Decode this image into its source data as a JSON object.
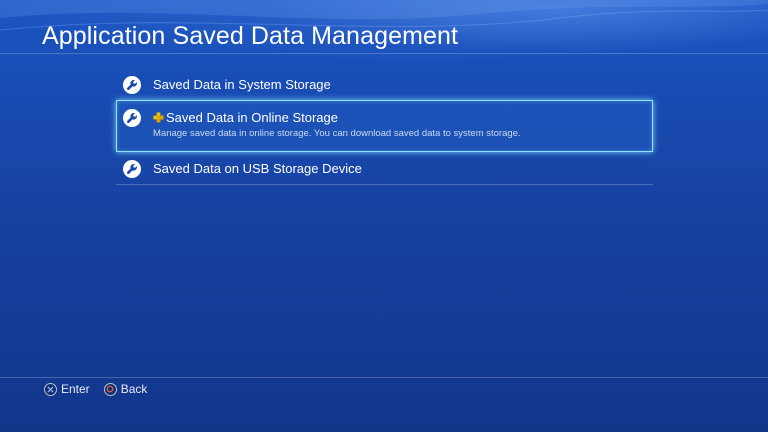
{
  "header": {
    "title": "Application Saved Data Management"
  },
  "menu": {
    "items": [
      {
        "label": "Saved Data in System Storage",
        "icon": "wrench-icon"
      },
      {
        "label": "Saved Data in Online Storage",
        "description": "Manage saved data in online storage. You can download saved data to system storage.",
        "icon": "wrench-icon",
        "badge_icon": "ps-plus-icon",
        "selected": true
      },
      {
        "label": "Saved Data on USB Storage Device",
        "icon": "wrench-icon"
      }
    ]
  },
  "footer": {
    "enter_label": "Enter",
    "back_label": "Back",
    "enter_icon": "cross-button-icon",
    "back_icon": "circle-button-icon"
  },
  "colors": {
    "background": "#1848ad",
    "selection_border": "#8fe3ff",
    "ps_plus": "#f5c400",
    "circle_button": "#e0604a"
  }
}
